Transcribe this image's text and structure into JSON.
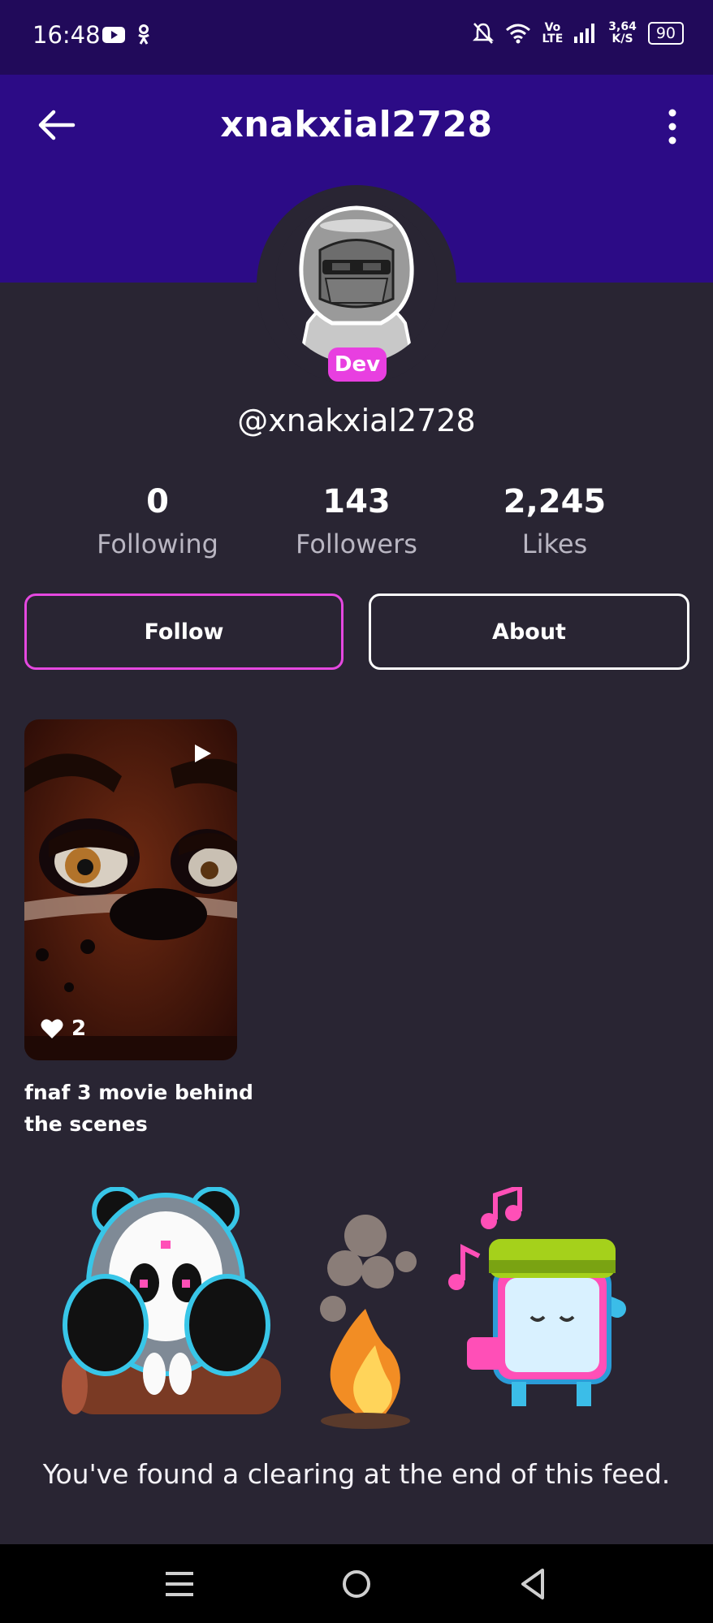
{
  "status_bar": {
    "time": "16:48",
    "network_speed": "3,64",
    "network_speed_unit": "K/S",
    "battery": "90",
    "volte_label": "Vo",
    "lte_label": "LTE"
  },
  "header": {
    "title": "xnakxial2728"
  },
  "profile": {
    "badge": "Dev",
    "handle": "@xnakxial2728",
    "stats": [
      {
        "value": "0",
        "label": "Following"
      },
      {
        "value": "143",
        "label": "Followers"
      },
      {
        "value": "2,245",
        "label": "Likes"
      }
    ],
    "follow_label": "Follow",
    "about_label": "About"
  },
  "videos": [
    {
      "title": "fnaf 3 movie behind the scenes",
      "likes": "2"
    }
  ],
  "footer": {
    "end_message": "You've found a clearing at the end of this feed."
  },
  "colors": {
    "status_bg": "#210a5a",
    "header_bg": "#2c0b86",
    "page_bg": "#292533",
    "accent": "#e548e0"
  }
}
